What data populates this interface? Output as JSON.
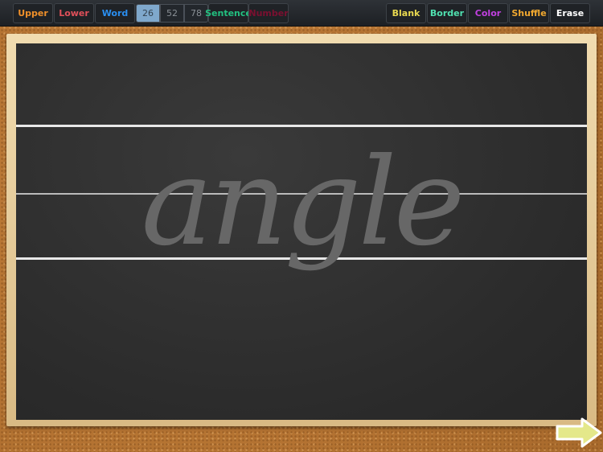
{
  "toolbar": {
    "left": [
      {
        "label": "Upper",
        "color": "#f0902a"
      },
      {
        "label": "Lower",
        "color": "#e0505a"
      },
      {
        "label": "Word",
        "color": "#2a8ef0"
      }
    ],
    "counts": [
      {
        "label": "26",
        "selected": true
      },
      {
        "label": "52",
        "selected": false
      },
      {
        "label": "78",
        "selected": false
      }
    ],
    "left2": [
      {
        "label": "Sentence",
        "color": "#22c080"
      },
      {
        "label": "Number",
        "color": "#7a1030"
      }
    ],
    "right": [
      {
        "label": "Blank",
        "color": "#e8d850"
      },
      {
        "label": "Border",
        "color": "#50e0b0"
      },
      {
        "label": "Color",
        "color": "#c040e0"
      },
      {
        "label": "Shuffle",
        "color": "#f0a830"
      },
      {
        "label": "Erase",
        "color": "#ffffff"
      }
    ]
  },
  "board": {
    "word": "angle"
  },
  "next_icon": "arrow-right-icon"
}
